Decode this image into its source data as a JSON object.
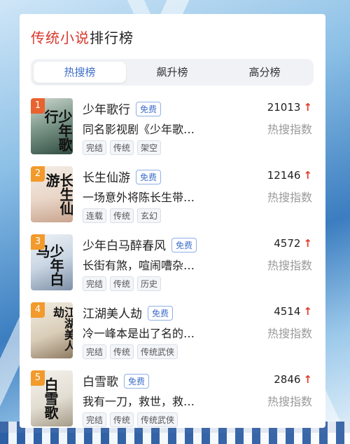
{
  "title": {
    "part1": "传统小说",
    "part2": "排行榜"
  },
  "tabs": [
    {
      "label": "热搜榜",
      "active": true
    },
    {
      "label": "飙升榜",
      "active": false
    },
    {
      "label": "高分榜",
      "active": false
    }
  ],
  "hot_label": "热搜指数",
  "trend_icon": "arrow-up-icon",
  "books": [
    {
      "rank": "1",
      "name": "少年歌行",
      "badge": "免费",
      "score": "21013",
      "desc": "同名影视剧《少年歌…",
      "tags": [
        "完结",
        "传统",
        "架空"
      ],
      "cover_text": "少年歌行"
    },
    {
      "rank": "2",
      "name": "长生仙游",
      "badge": "免费",
      "score": "12146",
      "desc": "一场意外将陈长生带…",
      "tags": [
        "连载",
        "传统",
        "玄幻"
      ],
      "cover_text": "长生仙游"
    },
    {
      "rank": "3",
      "name": "少年白马醉春风",
      "badge": "免费",
      "score": "4572",
      "desc": "长街有煞，喧闹嘈杂…",
      "tags": [
        "完结",
        "传统",
        "历史"
      ],
      "cover_text": "少年白马"
    },
    {
      "rank": "4",
      "name": "江湖美人劫",
      "badge": "免费",
      "score": "4514",
      "desc": "冷一峰本是出了名的…",
      "tags": [
        "完结",
        "传统",
        "传统武侠"
      ],
      "cover_text": "江湖美人劫"
    },
    {
      "rank": "5",
      "name": "白雪歌",
      "badge": "免费",
      "score": "2846",
      "desc": "我有一刀，救世，救…",
      "tags": [
        "完结",
        "传统",
        "传统武侠"
      ],
      "cover_text": "白雪歌"
    }
  ]
}
